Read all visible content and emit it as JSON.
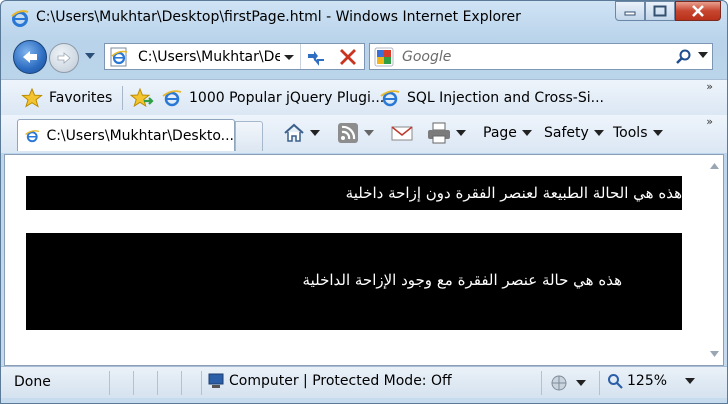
{
  "window": {
    "title": "C:\\Users\\Mukhtar\\Desktop\\firstPage.html - Windows Internet Explorer"
  },
  "address": {
    "url": "C:\\Users\\Mukhtar\\De"
  },
  "search": {
    "placeholder": "Google"
  },
  "favorites": {
    "label": "Favorites",
    "items": [
      {
        "label": "1000 Popular jQuery Plugi..."
      },
      {
        "label": "SQL Injection and Cross-Si..."
      }
    ]
  },
  "tab": {
    "label": "C:\\Users\\Mukhtar\\Deskto..."
  },
  "commands": {
    "page": "Page",
    "safety": "Safety",
    "tools": "Tools"
  },
  "content": {
    "para1": "هذه هي الحالة الطبيعة لعنصر الفقرة دون إزاحة داخلية",
    "para2": "هذه هي حالة عنصر الفقرة مع وجود الإزاحة الداخلية"
  },
  "status": {
    "text": "Done",
    "zone": "Computer | Protected Mode: Off",
    "zoom": "125%"
  }
}
